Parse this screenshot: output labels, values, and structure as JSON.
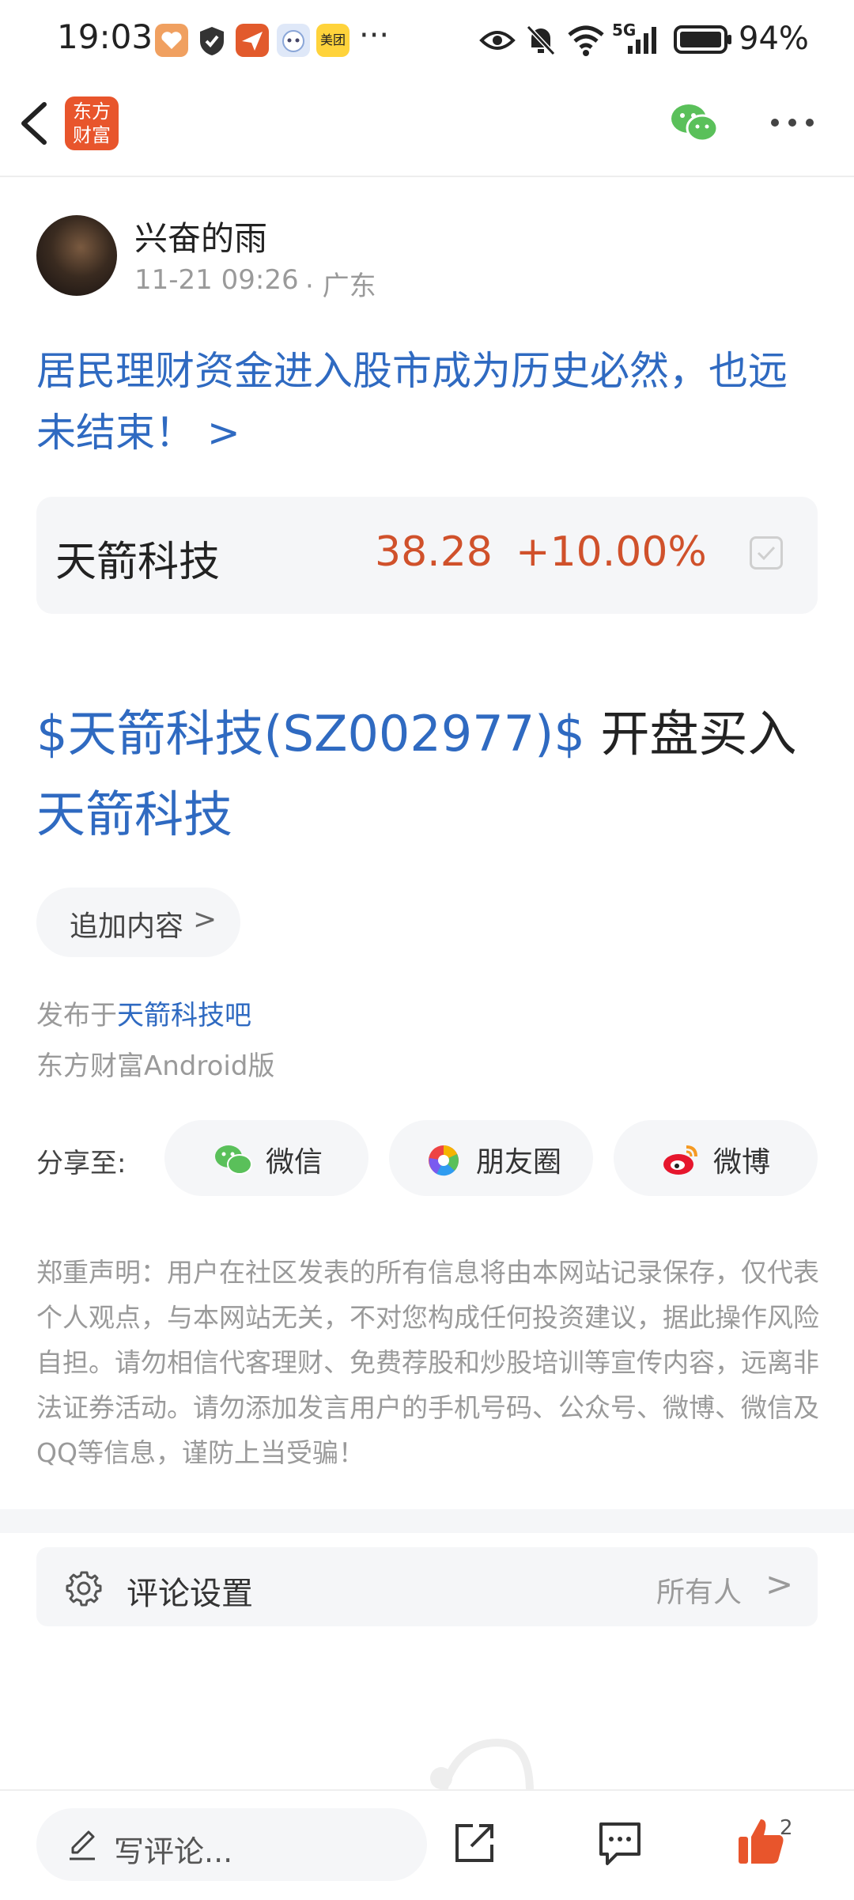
{
  "status_bar": {
    "time": "19:03",
    "app_icons": [
      {
        "name": "heart-app-icon",
        "color": "#f0a060"
      },
      {
        "name": "shield-app-icon",
        "color": "#333333"
      },
      {
        "name": "plane-app-icon",
        "color": "#e25a2c"
      },
      {
        "name": "face-app-icon",
        "color": "#dfe8f8"
      },
      {
        "name": "meituan-app-icon",
        "label": "美团",
        "color": "#ffd33b"
      }
    ],
    "more": "···",
    "network": "5G",
    "battery": "94%"
  },
  "nav": {
    "logo_text_1": "东方",
    "logo_text_2": "财富",
    "accent": "#e8552c"
  },
  "post": {
    "author": "兴奋的雨",
    "time": "11-21 09:26",
    "location": "· 广东",
    "title": "居民理财资金进入股市成为历史必然，也远未结束！ >",
    "stock": {
      "name": "天箭科技",
      "price": "38.28",
      "change": "+10.00%"
    },
    "body_tag": "$天箭科技(SZ002977)$",
    "body_text": " 开盘买入",
    "body_link": "天箭科技",
    "add_content": "追加内容",
    "add_chevron": ">",
    "published_prefix": "发布于",
    "published_bar": "天箭科技吧",
    "client": "东方财富Android版"
  },
  "share": {
    "label": "分享至:",
    "targets": [
      {
        "label": "微信",
        "icon": "wechat-icon"
      },
      {
        "label": "朋友圈",
        "icon": "moments-icon"
      },
      {
        "label": "微博",
        "icon": "weibo-icon"
      }
    ]
  },
  "disclaimer": "郑重声明：用户在社区发表的所有信息将由本网站记录保存，仅代表个人观点，与本网站无关，不对您构成任何投资建议，据此操作风险自担。请勿相信代客理财、免费荐股和炒股培训等宣传内容，远离非法证券活动。请勿添加发言用户的手机号码、公众号、微博、微信及QQ等信息，谨防上当受骗！",
  "comment_settings": {
    "title": "评论设置",
    "value": "所有人",
    "chevron": ">"
  },
  "bottom_bar": {
    "input_placeholder": "写评论...",
    "like_count": "2"
  },
  "colors": {
    "link_blue": "#2f6ac1",
    "price_red": "#d0512b",
    "like_orange": "#e8552c",
    "wechat_green": "#5ac05a"
  }
}
